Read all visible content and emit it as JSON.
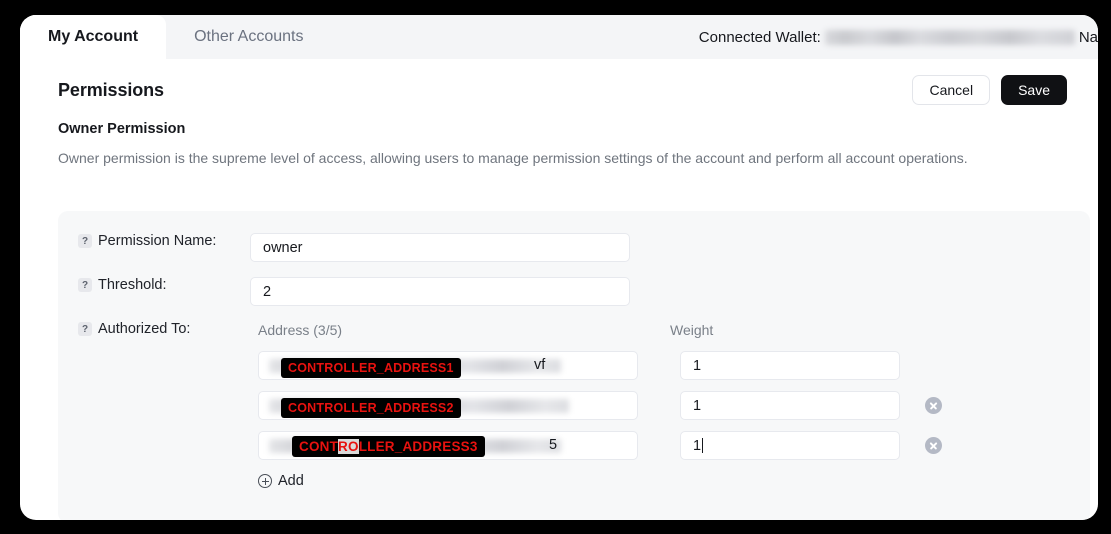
{
  "tabs": [
    {
      "label": "My Account",
      "active": true
    },
    {
      "label": "Other Accounts",
      "active": false
    }
  ],
  "wallet": {
    "label": "Connected Wallet:",
    "value_redacted": "",
    "tail": "Na"
  },
  "header": {
    "title": "Permissions",
    "cancel_label": "Cancel",
    "save_label": "Save"
  },
  "section": {
    "title": "Owner Permission",
    "description": "Owner permission is the supreme level of access, allowing users to manage permission settings of the account and perform all account operations."
  },
  "form": {
    "help_glyph": "?",
    "permission_name": {
      "label": "Permission Name:",
      "value": "owner"
    },
    "threshold": {
      "label": "Threshold:",
      "value": "2"
    },
    "authorized_to": {
      "label": "Authorized To:"
    },
    "columns": {
      "address": "Address (3/5)",
      "weight": "Weight"
    },
    "rows": [
      {
        "redaction_label": "CONTROLLER_ADDRESS1",
        "address_tail": "vf",
        "weight": "1",
        "deletable": false,
        "focused": false
      },
      {
        "redaction_label": "CONTROLLER_ADDRESS2",
        "address_tail": "",
        "weight": "1",
        "deletable": true,
        "focused": false
      },
      {
        "redaction_label_pre": "CONT",
        "redaction_label_sel": "RO",
        "redaction_label_post": "LLER_ADDRESS3",
        "redaction_label": "CONTROLLER_ADDRESS3",
        "address_tail": "5",
        "weight": "1",
        "deletable": true,
        "focused": true
      }
    ],
    "add_label": "Add"
  },
  "colors": {
    "redaction_bg": "#000000",
    "redaction_text": "#e8120f",
    "save_bg": "#101114",
    "panel_bg": "#f7f8f9",
    "tabbar_bg": "#f4f5f7"
  }
}
